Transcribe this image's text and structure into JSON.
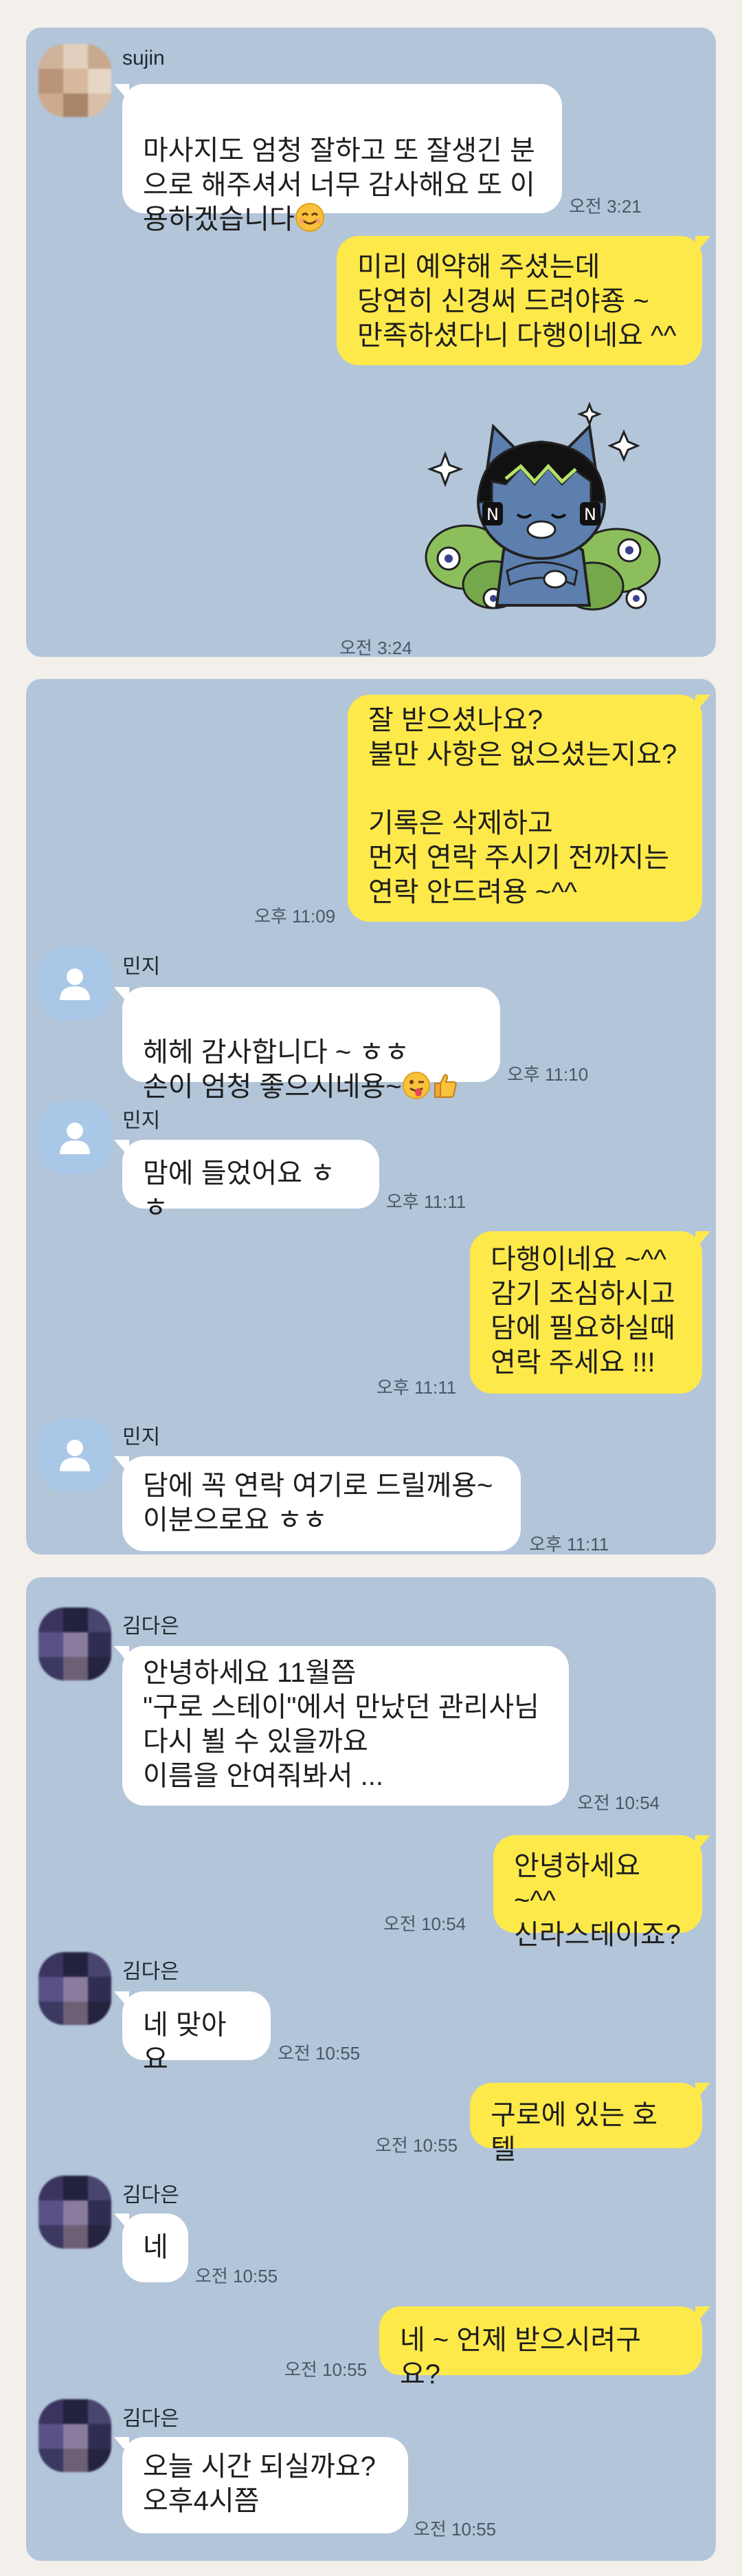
{
  "colors": {
    "panel_bg": "#b3c5d9",
    "incoming_bubble": "#ffffff",
    "outgoing_bubble": "#fee94a",
    "page_bg": "#f3efeb"
  },
  "panel1": {
    "sender": "sujin",
    "msg1": "마사지도 엄청 잘하고 또 잘생긴 분\n으로 해주셔서 너무 감사해요 또 이\n용하겠습니다",
    "msg1_emoji": "smiling-face",
    "msg1_time": "오전 3:21",
    "reply1": "미리 예약해 주셨는데\n당연히 신경써 드려야죵 ~\n만족하셨다니 다행이네요 ^^",
    "sticker_name": "cat-character-sticker",
    "sticker_time": "오전 3:24"
  },
  "panel2": {
    "out1": "잘 받으셨나요?\n불만 사항은 없으셨는지요?\n\n기록은 삭제하고\n먼저 연락 주시기 전까지는\n연락 안드려용 ~^^",
    "out1_time": "오후 11:09",
    "sender": "민지",
    "in1": "헤헤 감사합니다 ~ ㅎㅎ\n손이 엄청 좋으시네용~",
    "in1_emojis": "winking-tongue, thumbs-up",
    "in1_time": "오후 11:10",
    "in2": "맘에 들었어요 ㅎㅎ",
    "in2_time": "오후 11:11",
    "out2": "다행이네요 ~^^\n감기 조심하시고\n담에 필요하실때\n연락 주세요 !!!",
    "out2_time": "오후 11:11",
    "in3": "담에 꼭 연락 여기로 드릴께용~\n이분으로요 ㅎㅎ",
    "in3_time": "오후 11:11"
  },
  "panel3": {
    "sender": "김다은",
    "in1": "안녕하세요 11월쯤\n\"구로 스테이\"에서 만났던 관리사님\n다시 뵐 수 있을까요\n이름을 안여줘봐서 ...",
    "in1_time": "오전 10:54",
    "out1": "안녕하세요 ~^^\n신라스테이죠?",
    "out1_time": "오전 10:54",
    "in2": "네 맞아요",
    "in2_time": "오전 10:55",
    "out2": "구로에 있는 호텔",
    "out2_time": "오전 10:55",
    "in3": "네",
    "in3_time": "오전 10:55",
    "out3": "네 ~ 언제 받으시려구요?",
    "out3_time": "오전 10:55",
    "in4": "오늘  시간 되실까요?\n오후4시쯤",
    "in4_time": "오전 10:55"
  }
}
